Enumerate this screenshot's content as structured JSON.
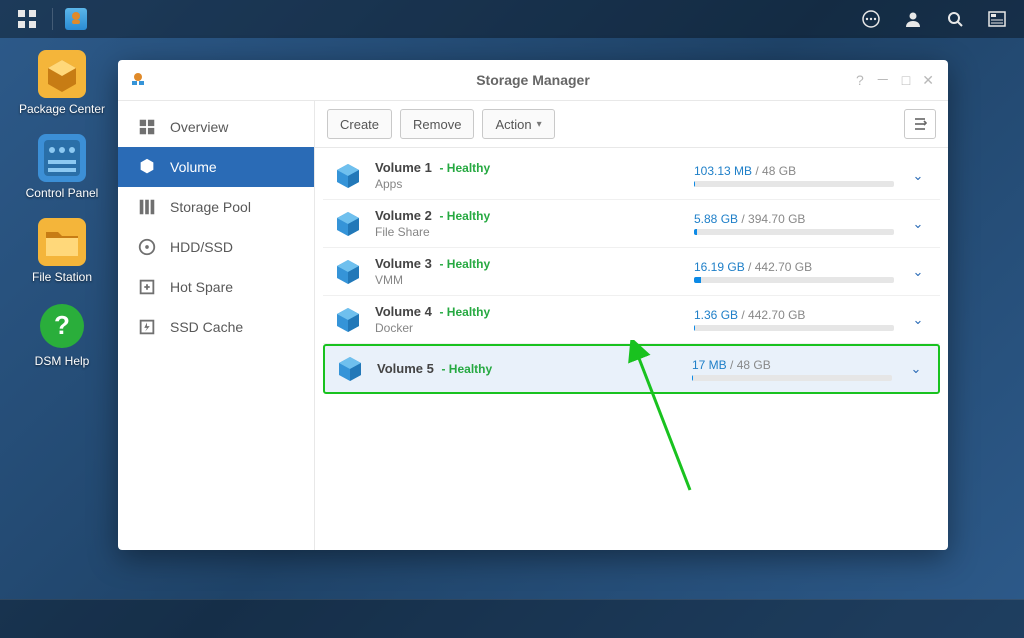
{
  "taskbar": {},
  "desktop": {
    "icons": [
      {
        "label": "Package Center",
        "color": "#f4b53a"
      },
      {
        "label": "Control Panel",
        "color": "#3c8fd6"
      },
      {
        "label": "File Station",
        "color": "#f4b53a"
      },
      {
        "label": "DSM Help",
        "color": "#2aae3b"
      }
    ]
  },
  "window": {
    "title": "Storage Manager"
  },
  "sidebar": {
    "items": [
      {
        "label": "Overview",
        "icon": "overview-icon"
      },
      {
        "label": "Volume",
        "icon": "volume-icon"
      },
      {
        "label": "Storage Pool",
        "icon": "storage-pool-icon"
      },
      {
        "label": "HDD/SSD",
        "icon": "hdd-icon"
      },
      {
        "label": "Hot Spare",
        "icon": "hotspare-icon"
      },
      {
        "label": "SSD Cache",
        "icon": "ssdcache-icon"
      }
    ],
    "active_index": 1
  },
  "toolbar": {
    "create": "Create",
    "remove": "Remove",
    "action": "Action"
  },
  "volumes": [
    {
      "name": "Volume 1",
      "status": "- Healthy",
      "subtitle": "Apps",
      "used": "103.13 MB",
      "total": "48 GB",
      "pct": 0.4
    },
    {
      "name": "Volume 2",
      "status": "- Healthy",
      "subtitle": "File Share",
      "used": "5.88 GB",
      "total": "394.70 GB",
      "pct": 1.5
    },
    {
      "name": "Volume 3",
      "status": "- Healthy",
      "subtitle": "VMM",
      "used": "16.19 GB",
      "total": "442.70 GB",
      "pct": 3.7
    },
    {
      "name": "Volume 4",
      "status": "- Healthy",
      "subtitle": "Docker",
      "used": "1.36 GB",
      "total": "442.70 GB",
      "pct": 0.4
    },
    {
      "name": "Volume 5",
      "status": "- Healthy",
      "subtitle": "",
      "used": "17 MB",
      "total": "48 GB",
      "pct": 0.2
    }
  ],
  "selected_index": 4
}
